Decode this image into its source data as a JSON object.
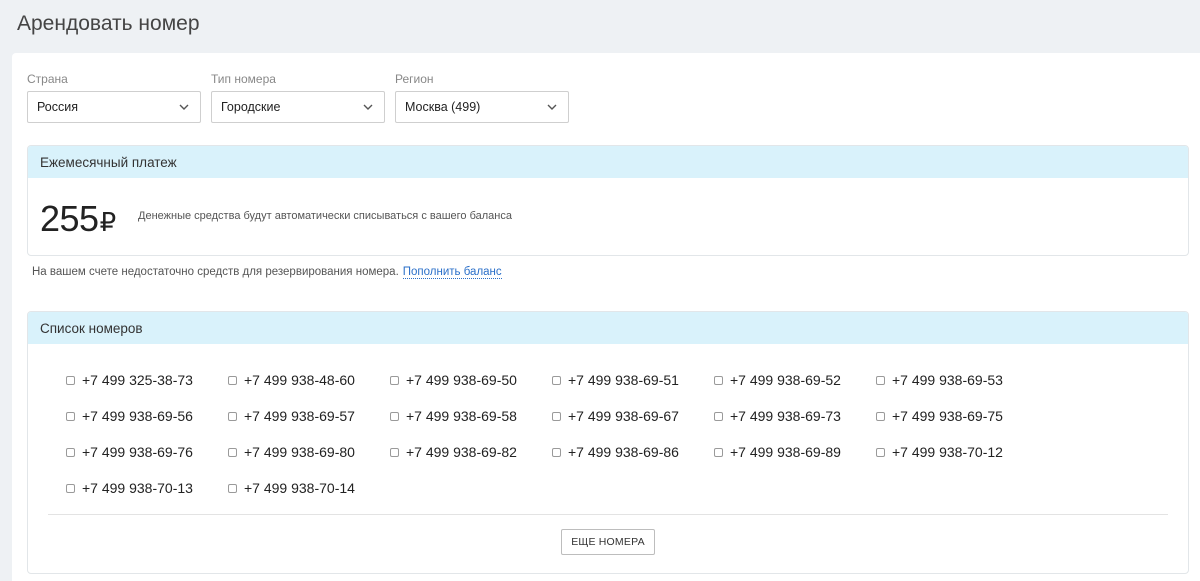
{
  "page": {
    "title": "Арендовать номер"
  },
  "filters": {
    "country": {
      "label": "Страна",
      "value": "Россия"
    },
    "type": {
      "label": "Тип номера",
      "value": "Городские"
    },
    "region": {
      "label": "Регион",
      "value": "Москва (499)"
    }
  },
  "payment": {
    "header": "Ежемесячный платеж",
    "amount": "255",
    "currency": "₽",
    "note": "Денежные средства будут автоматически списываться с вашего баланса"
  },
  "balance": {
    "warning": "На вашем счете недостаточно средств для резервирования номера.",
    "link": "Пополнить баланс"
  },
  "numbers": {
    "header": "Список номеров",
    "items": [
      "+7 499 325-38-73",
      "+7 499 938-48-60",
      "+7 499 938-69-50",
      "+7 499 938-69-51",
      "+7 499 938-69-52",
      "+7 499 938-69-53",
      "+7 499 938-69-56",
      "+7 499 938-69-57",
      "+7 499 938-69-58",
      "+7 499 938-69-67",
      "+7 499 938-69-73",
      "+7 499 938-69-75",
      "+7 499 938-69-76",
      "+7 499 938-69-80",
      "+7 499 938-69-82",
      "+7 499 938-69-86",
      "+7 499 938-69-89",
      "+7 499 938-70-12",
      "+7 499 938-70-13",
      "+7 499 938-70-14"
    ],
    "more_button": "ЕЩЕ НОМЕРА"
  }
}
